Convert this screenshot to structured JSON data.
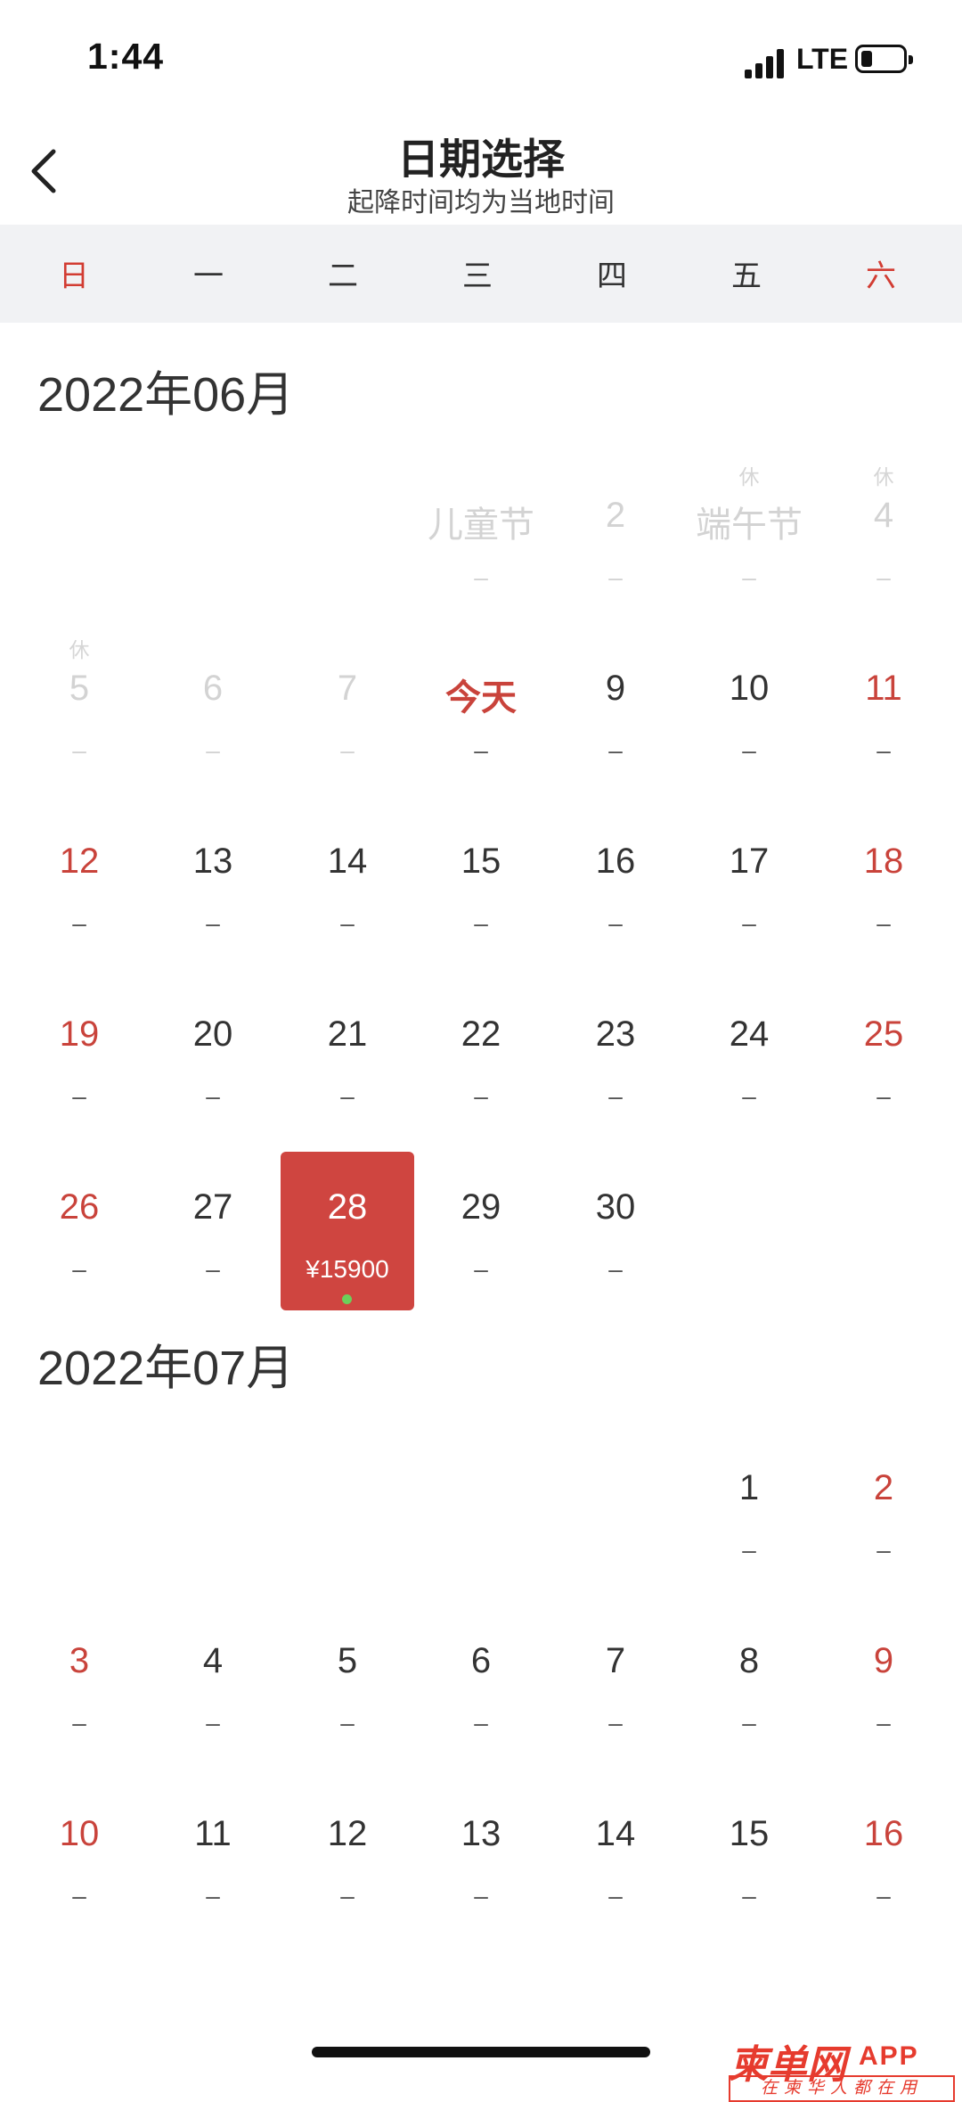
{
  "status": {
    "time": "1:44",
    "network": "LTE"
  },
  "nav": {
    "title": "日期选择",
    "subtitle": "起降时间均为当地时间"
  },
  "weekdays": [
    "日",
    "一",
    "二",
    "三",
    "四",
    "五",
    "六"
  ],
  "months": [
    {
      "title": "2022年06月",
      "leading_blanks": 3,
      "days": [
        {
          "label": "儿童节",
          "price": "–",
          "tag": "",
          "state": "past"
        },
        {
          "label": "2",
          "price": "–",
          "tag": "",
          "state": "past"
        },
        {
          "label": "端午节",
          "price": "–",
          "tag": "休",
          "state": "past"
        },
        {
          "label": "4",
          "price": "–",
          "tag": "休",
          "state": "past"
        },
        {
          "label": "5",
          "price": "–",
          "tag": "休",
          "state": "past"
        },
        {
          "label": "6",
          "price": "–",
          "tag": "",
          "state": "past"
        },
        {
          "label": "7",
          "price": "–",
          "tag": "",
          "state": "past"
        },
        {
          "label": "今天",
          "price": "–",
          "tag": "",
          "state": "today"
        },
        {
          "label": "9",
          "price": "–",
          "tag": "",
          "state": "normal"
        },
        {
          "label": "10",
          "price": "–",
          "tag": "",
          "state": "normal"
        },
        {
          "label": "11",
          "price": "–",
          "tag": "",
          "state": "normal"
        },
        {
          "label": "12",
          "price": "–",
          "tag": "",
          "state": "normal"
        },
        {
          "label": "13",
          "price": "–",
          "tag": "",
          "state": "normal"
        },
        {
          "label": "14",
          "price": "–",
          "tag": "",
          "state": "normal"
        },
        {
          "label": "15",
          "price": "–",
          "tag": "",
          "state": "normal"
        },
        {
          "label": "16",
          "price": "–",
          "tag": "",
          "state": "normal"
        },
        {
          "label": "17",
          "price": "–",
          "tag": "",
          "state": "normal"
        },
        {
          "label": "18",
          "price": "–",
          "tag": "",
          "state": "normal"
        },
        {
          "label": "19",
          "price": "–",
          "tag": "",
          "state": "normal"
        },
        {
          "label": "20",
          "price": "–",
          "tag": "",
          "state": "normal"
        },
        {
          "label": "21",
          "price": "–",
          "tag": "",
          "state": "normal"
        },
        {
          "label": "22",
          "price": "–",
          "tag": "",
          "state": "normal"
        },
        {
          "label": "23",
          "price": "–",
          "tag": "",
          "state": "normal"
        },
        {
          "label": "24",
          "price": "–",
          "tag": "",
          "state": "normal"
        },
        {
          "label": "25",
          "price": "–",
          "tag": "",
          "state": "normal"
        },
        {
          "label": "26",
          "price": "–",
          "tag": "",
          "state": "normal"
        },
        {
          "label": "27",
          "price": "–",
          "tag": "",
          "state": "normal"
        },
        {
          "label": "28",
          "price": "¥15900",
          "tag": "",
          "state": "selected"
        },
        {
          "label": "29",
          "price": "–",
          "tag": "",
          "state": "normal"
        },
        {
          "label": "30",
          "price": "–",
          "tag": "",
          "state": "normal"
        }
      ]
    },
    {
      "title": "2022年07月",
      "leading_blanks": 5,
      "days": [
        {
          "label": "1",
          "price": "–",
          "tag": "",
          "state": "normal"
        },
        {
          "label": "2",
          "price": "–",
          "tag": "",
          "state": "normal"
        },
        {
          "label": "3",
          "price": "–",
          "tag": "",
          "state": "normal"
        },
        {
          "label": "4",
          "price": "–",
          "tag": "",
          "state": "normal"
        },
        {
          "label": "5",
          "price": "–",
          "tag": "",
          "state": "normal"
        },
        {
          "label": "6",
          "price": "–",
          "tag": "",
          "state": "normal"
        },
        {
          "label": "7",
          "price": "–",
          "tag": "",
          "state": "normal"
        },
        {
          "label": "8",
          "price": "–",
          "tag": "",
          "state": "normal"
        },
        {
          "label": "9",
          "price": "–",
          "tag": "",
          "state": "normal"
        },
        {
          "label": "10",
          "price": "–",
          "tag": "",
          "state": "normal"
        },
        {
          "label": "11",
          "price": "–",
          "tag": "",
          "state": "normal"
        },
        {
          "label": "12",
          "price": "–",
          "tag": "",
          "state": "normal"
        },
        {
          "label": "13",
          "price": "–",
          "tag": "",
          "state": "normal"
        },
        {
          "label": "14",
          "price": "–",
          "tag": "",
          "state": "normal"
        },
        {
          "label": "15",
          "price": "–",
          "tag": "",
          "state": "normal"
        },
        {
          "label": "16",
          "price": "–",
          "tag": "",
          "state": "normal"
        }
      ]
    }
  ],
  "colors": {
    "accent": "#cf4540",
    "weekend": "#c9433b",
    "past": "#d3d3d3",
    "header_bg": "#f1f2f4",
    "selected_dot": "#6ccf5a"
  },
  "watermark": {
    "brand": "柬单网",
    "app": "APP",
    "slogan": "在柬华人都在用"
  }
}
